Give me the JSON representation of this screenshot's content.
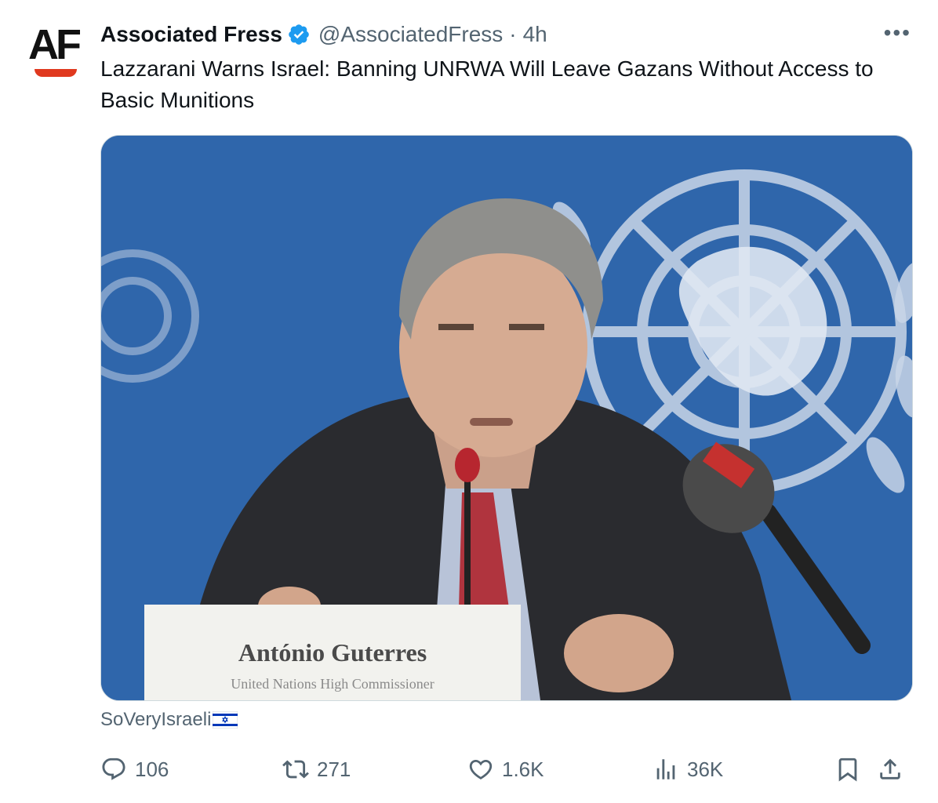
{
  "tweet": {
    "author_name": "Associated Fress",
    "handle": "@AssociatedFress",
    "separator": "·",
    "time": "4h",
    "more_label": "•••",
    "avatar_logo": "AF",
    "text": "Lazzarani Warns Israel: Banning UNRWA Will Leave Gazans Without Access to Basic Munitions"
  },
  "media": {
    "nameplate_text": "António Guterres",
    "nameplate_subtext": "United Nations High Commissioner"
  },
  "caption": {
    "text": "SoVeryIsraeli"
  },
  "actions": {
    "replies": "106",
    "retweets": "271",
    "likes": "1.6K",
    "views": "36K"
  },
  "icons": {
    "verified": "verified-badge-icon",
    "reply": "reply-icon",
    "retweet": "retweet-icon",
    "like": "heart-icon",
    "views": "views-chart-icon",
    "bookmark": "bookmark-icon",
    "share": "share-icon",
    "more": "more-options-icon",
    "flag": "israel-flag-icon"
  },
  "colors": {
    "text_primary": "#0f1419",
    "text_secondary": "#536471",
    "verified_blue": "#1d9bf0",
    "un_blue": "#2d63a8",
    "logo_red": "#e0391f"
  }
}
